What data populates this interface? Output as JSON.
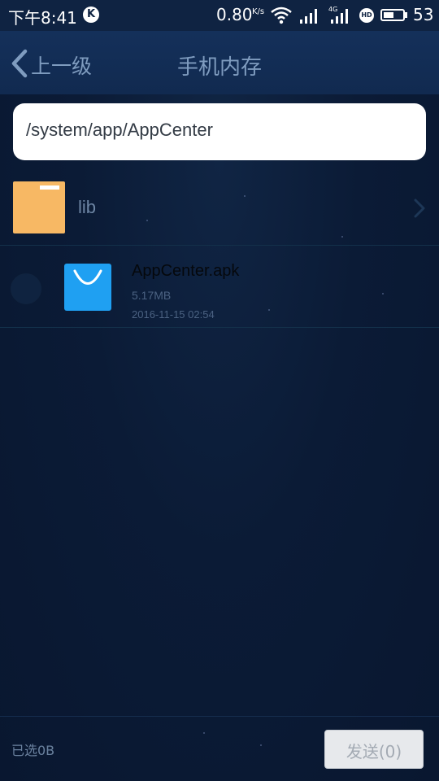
{
  "status_bar": {
    "time": "下午8:41",
    "k_badge": "K",
    "speed": "0.80",
    "speed_unit": "K/s",
    "network": "4G",
    "hd_badge": "HD",
    "battery": "53",
    "battery_level": 0.53
  },
  "header": {
    "back_label": "上一级",
    "title": "手机内存"
  },
  "path_bar": {
    "path": "/system/app/AppCenter"
  },
  "list": {
    "items": [
      {
        "type": "folder",
        "name": "lib",
        "icon": "folder-icon"
      },
      {
        "type": "file",
        "name": "AppCenter.apk",
        "size": "5.17MB",
        "date": "2016-11-15 02:54",
        "icon": "apk-icon"
      }
    ]
  },
  "footer": {
    "selected": "已选0B",
    "send_label": "发送(0)"
  },
  "colors": {
    "background": "#0b1b36",
    "header": "#112a50",
    "folder": "#f7b864",
    "apk": "#1fa0f2"
  }
}
